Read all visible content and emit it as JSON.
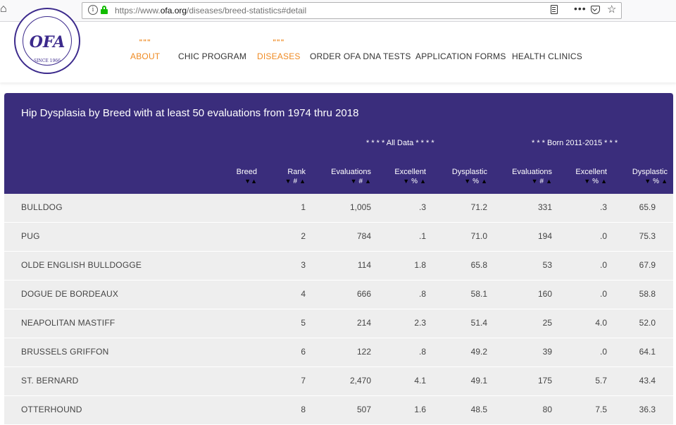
{
  "browser": {
    "url_prefix": "https://www.",
    "url_domain": "ofa.org",
    "url_path": "/diseases/breed-statistics#detail",
    "more_label": "•••",
    "info_label": "i"
  },
  "site": {
    "logo_text": "OFA",
    "logo_since": "SINCE 1966",
    "nav": [
      {
        "label": "ABOUT",
        "active": true,
        "dots": "\"\"\""
      },
      {
        "label": "CHIC PROGRAM",
        "active": false
      },
      {
        "label": "DISEASES",
        "active": true,
        "dots": "\"\"\""
      },
      {
        "label": "ORDER OFA DNA TESTS",
        "active": false
      },
      {
        "label": "APPLICATION FORMS",
        "active": false
      },
      {
        "label": "HEALTH CLINICS",
        "active": false
      }
    ]
  },
  "table": {
    "title": "Hip Dysplasia by Breed with at least 50 evaluations from 1974 thru 2018",
    "groups": {
      "all": "* * * * All Data * * * *",
      "born": "* * * Born 2011-2015 * * *"
    },
    "columns": [
      "Breed",
      "Rank",
      "Evaluations",
      "Excellent",
      "Dysplastic",
      "Evaluations",
      "Excellent",
      "Dysplastic"
    ],
    "sub": [
      "",
      "#",
      "#",
      "%",
      "%",
      "#",
      "%",
      "%"
    ],
    "rows": [
      {
        "breed": "BULLDOG",
        "rank": "1",
        "evals": "1,005",
        "exc": ".3",
        "dys": "71.2",
        "evals2": "331",
        "exc2": ".3",
        "dys2": "65.9"
      },
      {
        "breed": "PUG",
        "rank": "2",
        "evals": "784",
        "exc": ".1",
        "dys": "71.0",
        "evals2": "194",
        "exc2": ".0",
        "dys2": "75.3"
      },
      {
        "breed": "OLDE ENGLISH BULLDOGGE",
        "rank": "3",
        "evals": "114",
        "exc": "1.8",
        "dys": "65.8",
        "evals2": "53",
        "exc2": ".0",
        "dys2": "67.9"
      },
      {
        "breed": "DOGUE DE BORDEAUX",
        "rank": "4",
        "evals": "666",
        "exc": ".8",
        "dys": "58.1",
        "evals2": "160",
        "exc2": ".0",
        "dys2": "58.8"
      },
      {
        "breed": "NEAPOLITAN MASTIFF",
        "rank": "5",
        "evals": "214",
        "exc": "2.3",
        "dys": "51.4",
        "evals2": "25",
        "exc2": "4.0",
        "dys2": "52.0"
      },
      {
        "breed": "BRUSSELS GRIFFON",
        "rank": "6",
        "evals": "122",
        "exc": ".8",
        "dys": "49.2",
        "evals2": "39",
        "exc2": ".0",
        "dys2": "64.1"
      },
      {
        "breed": "ST. BERNARD",
        "rank": "7",
        "evals": "2,470",
        "exc": "4.1",
        "dys": "49.1",
        "evals2": "175",
        "exc2": "5.7",
        "dys2": "43.4"
      },
      {
        "breed": "OTTERHOUND",
        "rank": "8",
        "evals": "507",
        "exc": "1.6",
        "dys": "48.5",
        "evals2": "80",
        "exc2": "7.5",
        "dys2": "36.3"
      }
    ]
  },
  "colors": {
    "header_bg": "#3a2d7c",
    "accent": "#ef8a22",
    "table_bg": "#eeeeee",
    "lock": "#12bc00"
  }
}
